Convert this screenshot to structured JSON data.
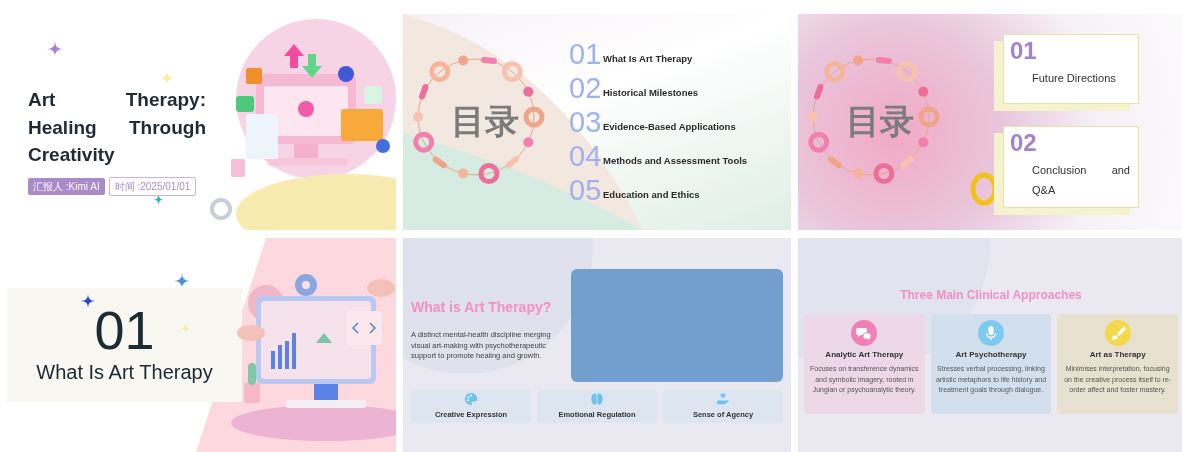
{
  "slides": [
    {
      "kind": "title",
      "title": "Art Therapy: Healing Through Creativity",
      "reporter": "汇报人 :Kimi AI",
      "date": "时间 :2025/01/01"
    },
    {
      "kind": "toc",
      "heading": "目录",
      "items": [
        {
          "number": "01",
          "label": "What Is Art Therapy"
        },
        {
          "number": "02",
          "label": "Historical Milestones"
        },
        {
          "number": "03",
          "label": "Evidence-Based Applications"
        },
        {
          "number": "04",
          "label": "Methods and Assessment Tools"
        },
        {
          "number": "05",
          "label": "Education and Ethics"
        }
      ]
    },
    {
      "kind": "toc_cards",
      "heading": "目录",
      "items": [
        {
          "number": "01",
          "label": "Future Directions"
        },
        {
          "number": "02",
          "label": "Conclusion and Q&A"
        }
      ]
    },
    {
      "kind": "section",
      "number": "01",
      "title": "What Is Art Therapy"
    },
    {
      "kind": "intro",
      "title": "What is Art Therapy?",
      "body": "A distinct mental-health discipline merging visual art-making with psychotherapeutic support to promote healing and growth.",
      "features": [
        {
          "label": "Creative Expression"
        },
        {
          "label": "Emotional Regulation"
        },
        {
          "label": "Sense of Agency"
        }
      ]
    },
    {
      "kind": "approaches",
      "title": "Three Main Clinical Approaches",
      "cards": [
        {
          "title": "Analytic Art Therapy",
          "body": "Focuses on transference dynamics and symbolic imagery, rooted in Jungian or psychoanalytic theory.",
          "color": "#f27fb8"
        },
        {
          "title": "Art Psychotherapy",
          "body": "Stresses verbal processing, linking artistic metaphors to life history and treatment goals through dialogue.",
          "color": "#7ecbf2"
        },
        {
          "title": "Art as Therapy",
          "body": "Minimises interpretation, focusing on the creative process itself to re-order affect and foster mastery.",
          "color": "#f5d84c"
        }
      ]
    }
  ]
}
